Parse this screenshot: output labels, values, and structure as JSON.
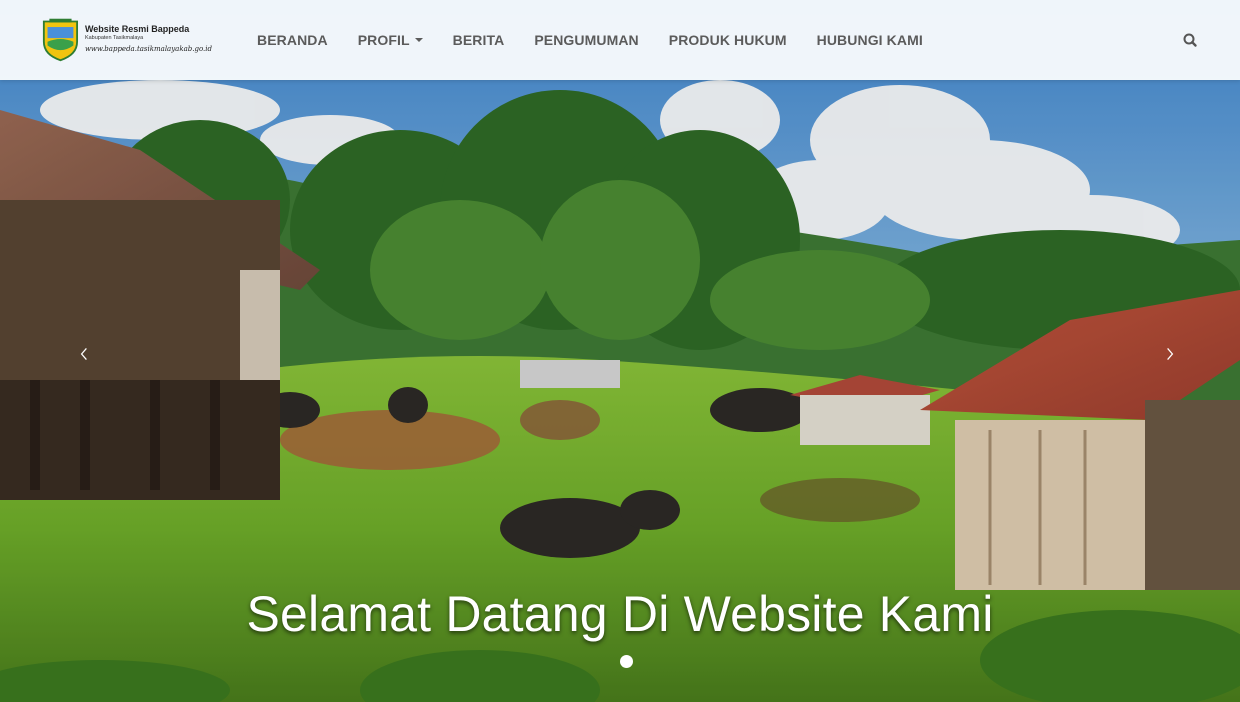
{
  "brand": {
    "title": "Website Resmi Bappeda",
    "subtitle": "Kabupaten Tasikmalaya",
    "url": "www.bappeda.tasikmalayakab.go.id"
  },
  "nav": {
    "items": [
      {
        "label": "BERANDA"
      },
      {
        "label": "PROFIL",
        "has_dropdown": true
      },
      {
        "label": "BERITA"
      },
      {
        "label": "PENGUMUMAN"
      },
      {
        "label": "PRODUK HUKUM"
      },
      {
        "label": "HUBUNGI KAMI"
      }
    ],
    "search_icon": "search-icon"
  },
  "carousel": {
    "caption": "Selamat Datang Di Website Kami",
    "prev_icon": "chevron-left-icon",
    "next_icon": "chevron-right-icon",
    "active_slide": 1,
    "slide_count": 1
  },
  "colors": {
    "nav_text": "#5b5b5b",
    "caption": "#ffffff"
  }
}
